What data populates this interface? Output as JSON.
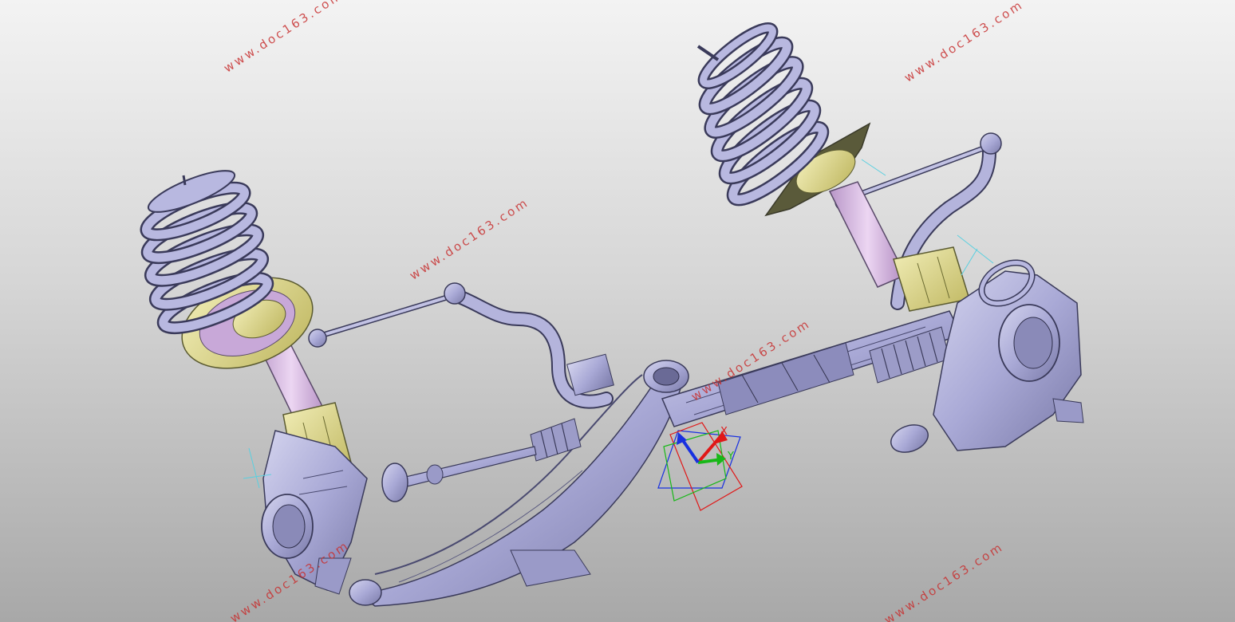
{
  "watermark": {
    "text": "www.doc163.com",
    "color": "#c83232"
  },
  "compass": {
    "x_label": "X",
    "y_label": "Y",
    "x_color": "#e01818",
    "y_color": "#18b818",
    "z_color": "#1830e0"
  },
  "model_colors": {
    "part_fill": "#a9a9d6",
    "part_stroke": "#3a3a5a",
    "strut_fill": "#d6b6e0",
    "bracket_fill": "#e8e29a",
    "background_top": "#f3f3f3",
    "background_bottom": "#a8a8a8"
  },
  "model_parts": [
    "left-coil-spring",
    "left-strut-damper",
    "left-steering-knuckle",
    "left-stabilizer-link",
    "right-coil-spring",
    "right-strut-damper",
    "right-steering-knuckle",
    "right-stabilizer-link",
    "stabilizer-bar",
    "steering-rack",
    "tie-rod",
    "lower-control-arm"
  ]
}
